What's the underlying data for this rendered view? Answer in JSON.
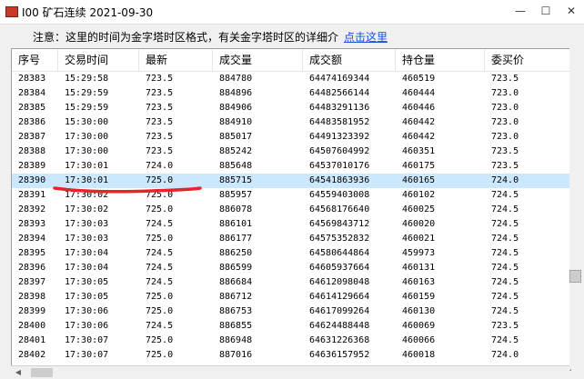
{
  "window": {
    "title": "I00 矿石连续 2021-09-30",
    "controls": {
      "minimize": "—",
      "maximize": "☐",
      "close": "✕"
    }
  },
  "notice": {
    "text": "注意：这里的时间为金字塔时区格式，有关金字塔时区的详细介",
    "link": "点击这里"
  },
  "table": {
    "columns": [
      "序号",
      "交易时间",
      "最新",
      "成交量",
      "成交额",
      "持仓量",
      "委买价"
    ],
    "rows": [
      [
        "28383",
        "15:29:58",
        "723.5",
        "884780",
        "64474169344",
        "460519",
        "723.5"
      ],
      [
        "28384",
        "15:29:59",
        "723.5",
        "884896",
        "64482566144",
        "460444",
        "723.0"
      ],
      [
        "28385",
        "15:29:59",
        "723.5",
        "884906",
        "64483291136",
        "460446",
        "723.0"
      ],
      [
        "28386",
        "15:30:00",
        "723.5",
        "884910",
        "64483581952",
        "460442",
        "723.0"
      ],
      [
        "28387",
        "17:30:00",
        "723.5",
        "885017",
        "64491323392",
        "460442",
        "723.0"
      ],
      [
        "28388",
        "17:30:00",
        "723.5",
        "885242",
        "64507604992",
        "460351",
        "723.5"
      ],
      [
        "28389",
        "17:30:01",
        "724.0",
        "885648",
        "64537010176",
        "460175",
        "723.5"
      ],
      [
        "28390",
        "17:30:01",
        "725.0",
        "885715",
        "64541863936",
        "460165",
        "724.0"
      ],
      [
        "28391",
        "17:30:02",
        "725.0",
        "885957",
        "64559403008",
        "460102",
        "724.5"
      ],
      [
        "28392",
        "17:30:02",
        "725.0",
        "886078",
        "64568176640",
        "460025",
        "724.5"
      ],
      [
        "28393",
        "17:30:03",
        "724.5",
        "886101",
        "64569843712",
        "460020",
        "724.5"
      ],
      [
        "28394",
        "17:30:03",
        "725.0",
        "886177",
        "64575352832",
        "460021",
        "724.5"
      ],
      [
        "28395",
        "17:30:04",
        "724.5",
        "886250",
        "64580644864",
        "459973",
        "724.5"
      ],
      [
        "28396",
        "17:30:04",
        "724.5",
        "886599",
        "64605937664",
        "460131",
        "724.5"
      ],
      [
        "28397",
        "17:30:05",
        "724.5",
        "886684",
        "64612098048",
        "460163",
        "724.5"
      ],
      [
        "28398",
        "17:30:05",
        "725.0",
        "886712",
        "64614129664",
        "460159",
        "724.5"
      ],
      [
        "28399",
        "17:30:06",
        "725.0",
        "886753",
        "64617099264",
        "460130",
        "724.5"
      ],
      [
        "28400",
        "17:30:06",
        "724.5",
        "886855",
        "64624488448",
        "460069",
        "723.5"
      ],
      [
        "28401",
        "17:30:07",
        "725.0",
        "886948",
        "64631226368",
        "460066",
        "724.5"
      ],
      [
        "28402",
        "17:30:07",
        "725.0",
        "887016",
        "64636157952",
        "460018",
        "724.0"
      ]
    ],
    "selected_row": 7
  },
  "colors": {
    "selection": "#cce8ff",
    "annotation": "#e8232a",
    "link": "#1a4fd6"
  }
}
